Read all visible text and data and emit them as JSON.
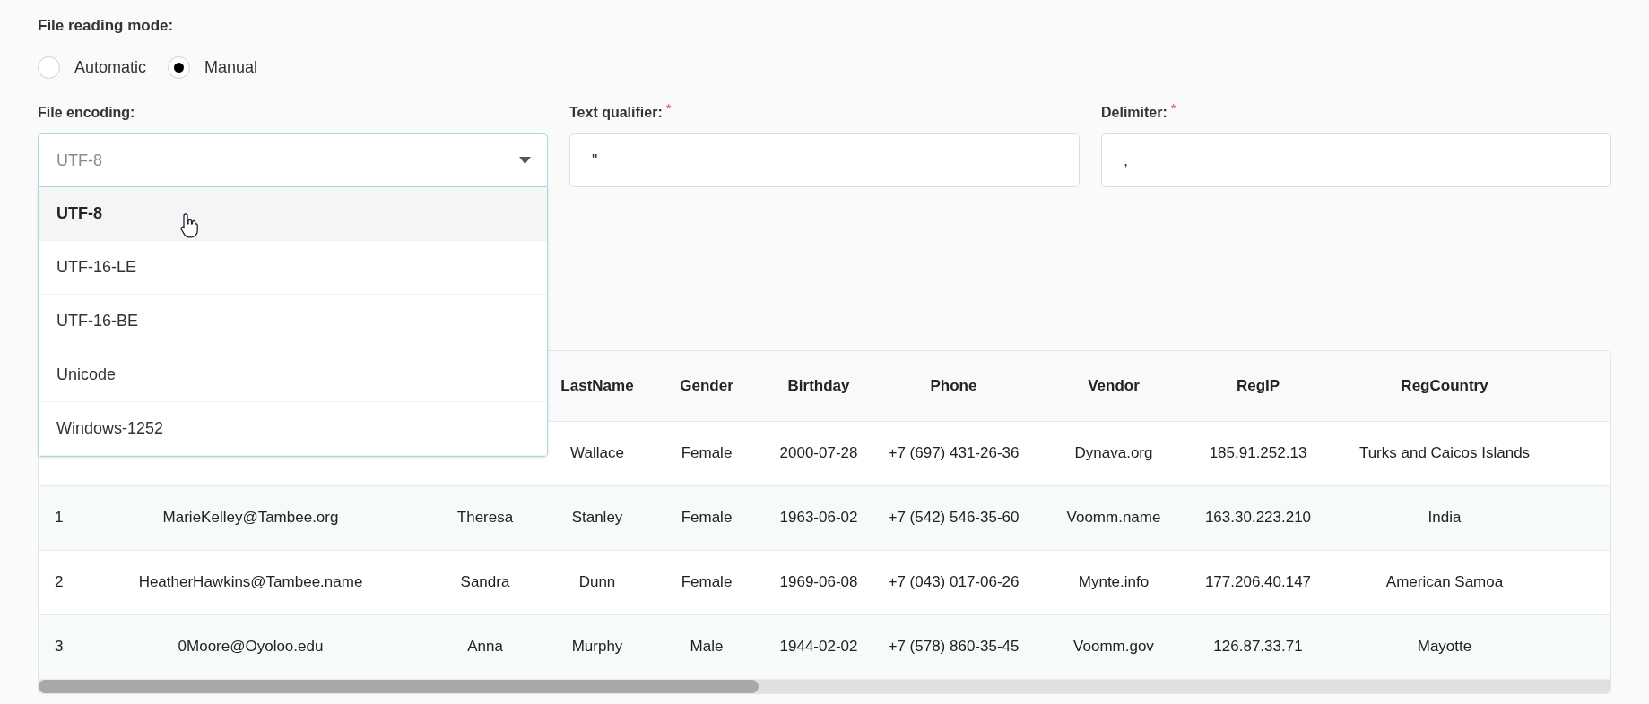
{
  "reading_mode": {
    "label": "File reading mode:",
    "options": [
      {
        "label": "Automatic",
        "selected": false
      },
      {
        "label": "Manual",
        "selected": true
      }
    ]
  },
  "fields": [
    {
      "kind": "select",
      "label": "File encoding:",
      "value": "UTF-8",
      "expanded": true,
      "options": [
        {
          "label": "UTF-8",
          "selected": true
        },
        {
          "label": "UTF-16-LE",
          "selected": false
        },
        {
          "label": "UTF-16-BE",
          "selected": false
        },
        {
          "label": "Unicode",
          "selected": false
        },
        {
          "label": "Windows-1252",
          "selected": false
        }
      ]
    },
    {
      "kind": "text",
      "label": "Text qualifier:",
      "required_mark": "*",
      "value": "\""
    },
    {
      "kind": "text",
      "label": "Delimiter:",
      "required_mark": "*",
      "value": ","
    }
  ],
  "table": {
    "columns": [
      "LastName",
      "Gender",
      "Birthday",
      "Phone",
      "Vendor",
      "RegIP",
      "RegCountry"
    ],
    "rows": [
      {
        "last_name": "Wallace",
        "gender": "Female",
        "birthday": "2000-07-28",
        "phone": "+7 (697) 431-26-36",
        "vendor": "Dynava.org",
        "reg_ip": "185.91.252.13",
        "reg_country": "Turks and Caicos Islands"
      },
      {
        "index": "1",
        "email": "MarieKelley@Tambee.org",
        "first_name": "Theresa",
        "last_name": "Stanley",
        "gender": "Female",
        "birthday": "1963-06-02",
        "phone": "+7 (542) 546-35-60",
        "vendor": "Voomm.name",
        "reg_ip": "163.30.223.210",
        "reg_country": "India"
      },
      {
        "index": "2",
        "email": "HeatherHawkins@Tambee.name",
        "first_name": "Sandra",
        "last_name": "Dunn",
        "gender": "Female",
        "birthday": "1969-06-08",
        "phone": "+7 (043) 017-06-26",
        "vendor": "Mynte.info",
        "reg_ip": "177.206.40.147",
        "reg_country": "American Samoa"
      },
      {
        "index": "3",
        "email": "0Moore@Oyoloo.edu",
        "first_name": "Anna",
        "last_name": "Murphy",
        "gender": "Male",
        "birthday": "1944-02-02",
        "phone": "+7 (578) 860-35-45",
        "vendor": "Voomm.gov",
        "reg_ip": "126.87.33.71",
        "reg_country": "Mayotte"
      }
    ]
  }
}
